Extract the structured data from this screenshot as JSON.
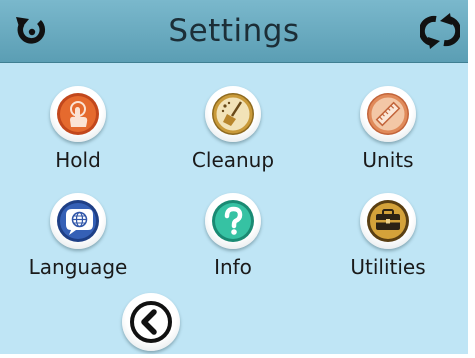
{
  "header": {
    "title": "Settings",
    "home_icon": "home-restart-icon",
    "refresh_icon": "refresh-icon"
  },
  "menu": {
    "items": [
      {
        "label": "Hold",
        "icon": "hold-hand-icon",
        "color": "#e0602a"
      },
      {
        "label": "Cleanup",
        "icon": "cleanup-broom-icon",
        "color": "#c9a03e"
      },
      {
        "label": "Units",
        "icon": "units-ruler-icon",
        "color": "#e08a5a"
      },
      {
        "label": "Language",
        "icon": "language-globe-icon",
        "color": "#2f55a8"
      },
      {
        "label": "Info",
        "icon": "info-question-icon",
        "color": "#2fb59a"
      },
      {
        "label": "Utilities",
        "icon": "utilities-toolbox-icon",
        "color": "#c99a2e"
      }
    ]
  },
  "footer": {
    "back_icon": "back-chevron-icon"
  },
  "colors": {
    "background": "#bfe5f5",
    "header": "#6aaec4"
  }
}
